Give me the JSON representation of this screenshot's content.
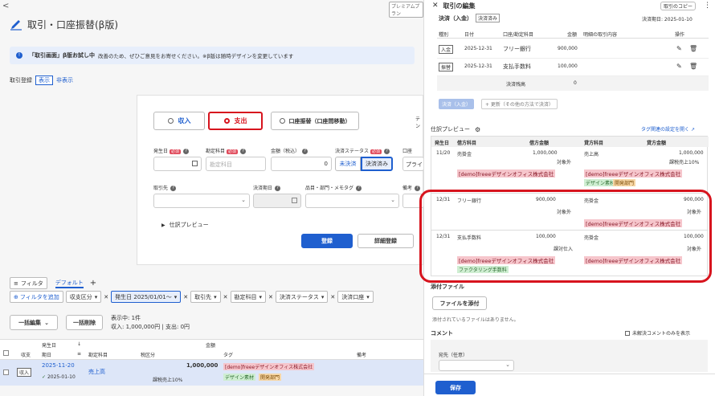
{
  "top_left_chevron": "<",
  "top_badge": "プレミアムプラン",
  "page_title": "取引・口座振替(β版)",
  "banner": {
    "strong": "「取引画面」β版お試し中",
    "text": "改善のため、ぜひご意見をお寄せください。※β版は随時デザインを変更しています"
  },
  "registration": {
    "label": "取引登録",
    "show": "表示",
    "hide": "非表示"
  },
  "type_tabs": {
    "income": "収入",
    "expense": "支出",
    "transfer": "口座振替（口座間移動）"
  },
  "form": {
    "date_label": "発生日",
    "account_label": "勘定科目",
    "account_placeholder": "勘定科目",
    "amount_label": "金額（税込）",
    "amount_value": "0",
    "status_label": "決済ステータス",
    "status_unsettled": "未決済",
    "status_settled": "決済済み",
    "method_label": "口座",
    "method_value": "プライ",
    "partner_label": "取引先",
    "settle_date_label": "決済期日",
    "item_label": "品目・部門・メモタグ",
    "note_label": "備考",
    "required": "必須",
    "preview_toggle": "仕訳プレビュー",
    "register_button": "登録",
    "detail_register_button": "詳細登録",
    "side_cut": "テン"
  },
  "filter_bar": {
    "filter": "フィルタ",
    "default": "デフォルト",
    "plus": "+",
    "add_filter": "フィルタを追加",
    "chips": [
      "収支区分",
      "発生日 2025/01/01〜",
      "取引先",
      "勘定科目",
      "決済ステータス",
      "決済口座"
    ]
  },
  "bulk": {
    "edit": "一括編集",
    "delete": "一括削除",
    "showing": "表示中: 1件",
    "summary": "収入: 1,000,000円 | 支出: 0円"
  },
  "list_header": {
    "date": "発生日",
    "settle": "期日",
    "type": "収支",
    "account": "勘定科目",
    "tax": "税区分",
    "amount": "金額",
    "tag": "タグ",
    "note": "備考"
  },
  "list_row": {
    "type": "収入",
    "date": "2025-11-20",
    "settle_date": "2025-01-10",
    "account": "売上高",
    "amount": "1,000,000",
    "tax": "課税売上10%",
    "tag_partner": "[demo]freeeデザインオフィス株式会社",
    "tag_item": "デザイン素材",
    "tag_dept": "開発部門"
  },
  "drawer": {
    "title": "取引の編集",
    "copy_button": "取引のコピー",
    "more": "⋮",
    "settle_header": "決済（入金）",
    "settle_badge": "決済済み",
    "settle_due": "決済期日: 2025-01-10",
    "settle_columns": [
      "種別",
      "日付",
      "口座/勘定科目",
      "金額",
      "明細の取引内容",
      "操作"
    ],
    "settle_rows": [
      {
        "kind": "入金",
        "date": "2025-12-31",
        "account": "フリー銀行",
        "amount": "900,000"
      },
      {
        "kind": "振替",
        "date": "2025-12-31",
        "account": "支払手数料",
        "amount": "100,000"
      }
    ],
    "remaining_label": "決済残高",
    "remaining_value": "0",
    "settle_tab": "決済（入金）",
    "update_tab": "+ 更新（その他の方法で決済）",
    "journal_title": "仕訳プレビュー",
    "tag_link": "タグ関連の設定を開く",
    "journal_columns": [
      "発生日",
      "借方科目",
      "借方金額",
      "貸方科目",
      "貸方金額"
    ],
    "journal": [
      {
        "date": "11/20",
        "debit": "売掛金",
        "debit_amount": "1,000,000",
        "debit_tax": "対象外",
        "credit": "売上高",
        "credit_amount": "1,000,000",
        "credit_tax": "課税売上10%",
        "debit_tags": [
          "[demo]freeeデザインオフィス株式会社"
        ],
        "credit_tags": [
          "[demo]freeeデザインオフィス株式会社"
        ],
        "credit_extra": [
          "デザイン素材",
          "開発部門"
        ]
      },
      {
        "date": "12/31",
        "debit": "フリー銀行",
        "debit_amount": "900,000",
        "debit_tax": "対象外",
        "credit": "売掛金",
        "credit_amount": "900,000",
        "credit_tax": "対象外",
        "debit_tags": [],
        "credit_tags": [
          "[demo]freeeデザインオフィス株式会社"
        ],
        "credit_extra": []
      },
      {
        "date": "12/31",
        "debit": "支払手数料",
        "debit_amount": "100,000",
        "debit_tax": "課対仕入",
        "credit": "売掛金",
        "credit_amount": "100,000",
        "credit_tax": "対象外",
        "debit_tags": [
          "[demo]freeeデザインオフィス株式会社"
        ],
        "credit_tags": [
          "[demo]freeeデザインオフィス株式会社"
        ],
        "debit_extra": [
          "ファクタリング手数料"
        ]
      }
    ],
    "attach_title": "添付ファイル",
    "attach_button": "ファイルを添付",
    "attach_empty": "添付されているファイルはありません。",
    "comment_title": "コメント",
    "comment_filter": "未解決コメントのみを表示",
    "comment_to": "宛先（任意）",
    "save_button": "保存"
  },
  "colors": {
    "accent": "#1f5fcf",
    "highlight": "#d7141e",
    "expense": "#d7141e"
  }
}
